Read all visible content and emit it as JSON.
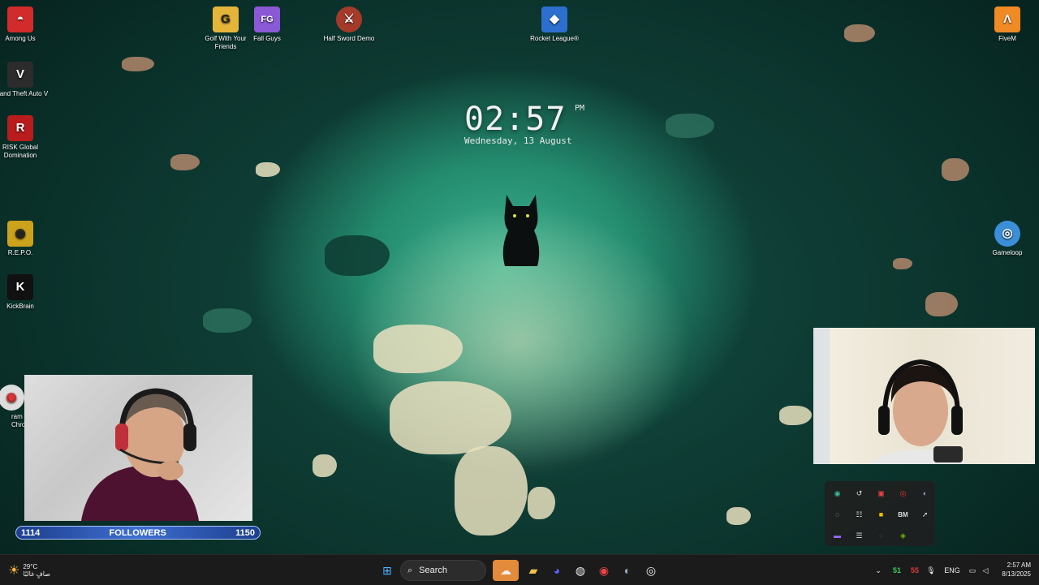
{
  "desktop_icons": [
    {
      "label": "Among Us",
      "icon": "among-us-icon",
      "symbol": "◓",
      "bg": "#d12b2b"
    },
    {
      "label": "Grand Theft Auto V",
      "icon": "gta-v-icon",
      "symbol": "V",
      "bg": "#2c2c2c"
    },
    {
      "label": "RISK Global Domination",
      "icon": "risk-icon",
      "symbol": "R",
      "bg": "#b81c1c"
    },
    {
      "label": "R.E.P.O.",
      "icon": "repo-icon",
      "symbol": "◉",
      "bg": "#caa21c"
    },
    {
      "label": "KickBrain",
      "icon": "kickbrain-icon",
      "symbol": "K",
      "bg": "#111111"
    },
    {
      "label": "Golf With Your Friends",
      "icon": "golf-icon",
      "symbol": "G",
      "bg": "#e5b53a"
    },
    {
      "label": "Fall Guys",
      "icon": "fall-guys-icon",
      "symbol": "FG",
      "bg": "#8b59d6"
    },
    {
      "label": "Half Sword Demo",
      "icon": "half-sword-icon",
      "symbol": "⚔",
      "bg": "#a63a2a"
    },
    {
      "label": "Rocket League®",
      "icon": "rocket-league-icon",
      "symbol": "◆",
      "bg": "#2c6fcf"
    },
    {
      "label": "FiveM",
      "icon": "fivem-icon",
      "symbol": "Λ",
      "bg": "#f08a24"
    },
    {
      "label": "Gameloop",
      "icon": "gameloop-icon",
      "symbol": "◎",
      "bg": "#3a8fd8"
    },
    {
      "label": "ram Chro",
      "icon": "chrome-icon",
      "symbol": "◉",
      "bg": "#dddddd"
    }
  ],
  "clock": {
    "time": "02:57",
    "ampm": "PM",
    "date": "Wednesday, 13 August"
  },
  "overlay": {
    "followers_label": "FOLLOWERS",
    "followers_current": "1114",
    "followers_goal": "1150",
    "progress_fraction": 0.97
  },
  "tray_overflow_icons": [
    "edge-icon",
    "arrow-icon",
    "app-icon",
    "red-circle-icon",
    "steam-icon",
    "circle-icon",
    "ear-icon",
    "yellow-square-icon",
    "bm-icon",
    "cursor-icon",
    "purple-icon",
    "server-icon",
    "blank-icon",
    "nvidia-icon"
  ],
  "tray_overflow_bm": "BM",
  "taskbar": {
    "weather_temp": "29°C",
    "weather_desc": "صافٍ غالبًا",
    "search_placeholder": "Search",
    "language": "ENG",
    "time": "2:57 AM",
    "date": "8/13/2025",
    "fps_green": "51",
    "fps_red": "55"
  }
}
